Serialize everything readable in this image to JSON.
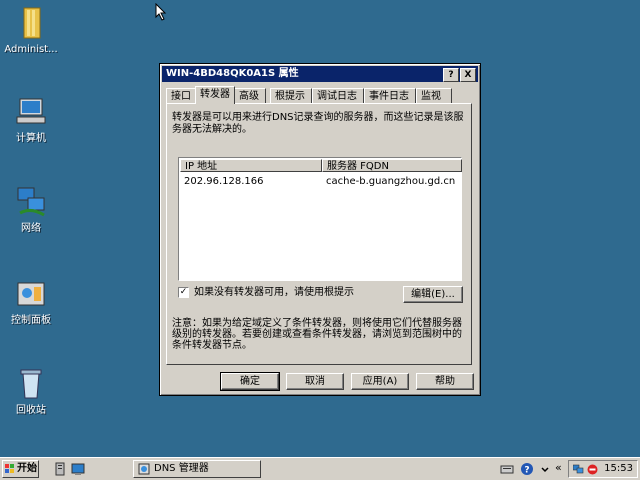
{
  "desktop": {
    "icons": [
      {
        "label": "Administ..."
      },
      {
        "label": "计算机"
      },
      {
        "label": "网络"
      },
      {
        "label": "控制面板"
      },
      {
        "label": "回收站"
      }
    ]
  },
  "dialog": {
    "title": "WIN-4BD48QK0A1S 属性",
    "help_btn": "?",
    "close_btn": "X",
    "tabs": [
      "接口",
      "转发器",
      "高级",
      "根提示",
      "调试日志",
      "事件日志",
      "监视"
    ],
    "active_tab": "转发器",
    "description": "转发器是可以用来进行DNS记录查询的服务器，而这些记录是该服务器无法解决的。",
    "list": {
      "columns": [
        "IP 地址",
        "服务器 FQDN"
      ],
      "rows": [
        {
          "ip": "202.96.128.166",
          "fqdn": "cache-b.guangzhou.gd.cn"
        }
      ]
    },
    "use_root_hints": {
      "checked_mark": "✓",
      "label": "如果没有转发器可用，请使用根提示"
    },
    "edit_btn": "编辑(E)...",
    "note": "注意：如果为给定域定义了条件转发器，则将使用它们代替服务器级别的转发器。若要创建或查看条件转发器，请浏览到范围树中的条件转发器节点。",
    "buttons": {
      "ok": "确定",
      "cancel": "取消",
      "apply": "应用(A)",
      "help": "帮助"
    }
  },
  "taskbar": {
    "start_label": "开始",
    "tasks": [
      {
        "label": "DNS 管理器"
      }
    ],
    "tray": {
      "time": "15:53",
      "chevron": "«"
    }
  }
}
